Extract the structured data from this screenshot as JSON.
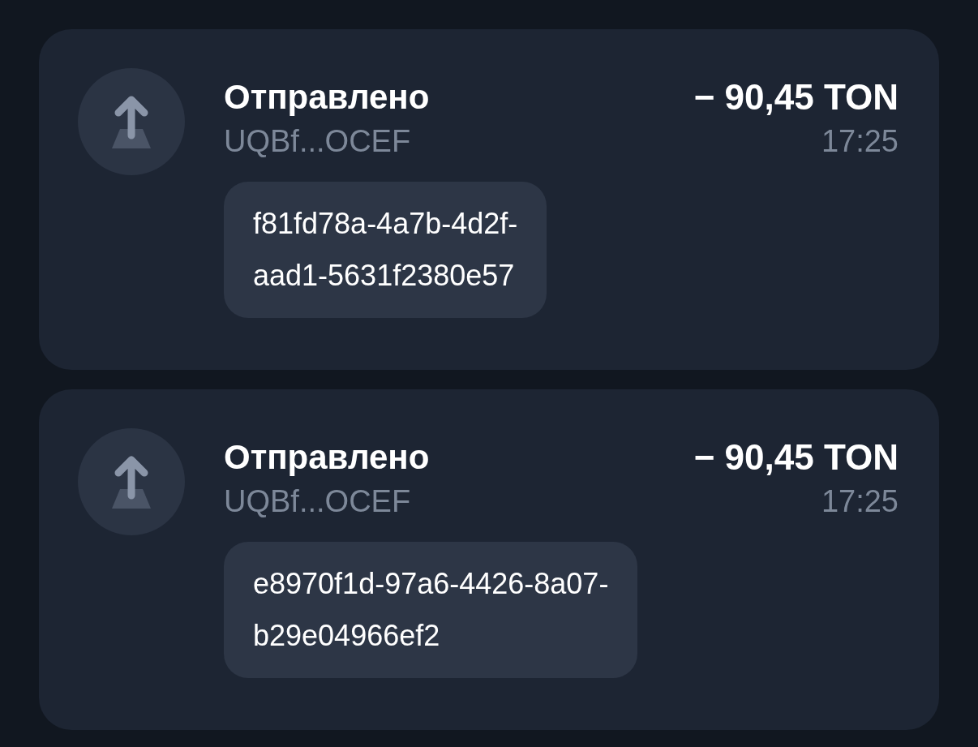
{
  "transactions": [
    {
      "title": "Отправлено",
      "address": "UQBf...OCEF",
      "amount": "− 90,45 TON",
      "time": "17:25",
      "comment_lines": [
        "f81fd78a-4a7b-4d2f-",
        "aad1-5631f2380e57"
      ]
    },
    {
      "title": "Отправлено",
      "address": "UQBf...OCEF",
      "amount": "− 90,45 TON",
      "time": "17:25",
      "comment_lines": [
        "e8970f1d-97a6-4426-8a07-",
        "b29e04966ef2"
      ]
    }
  ]
}
